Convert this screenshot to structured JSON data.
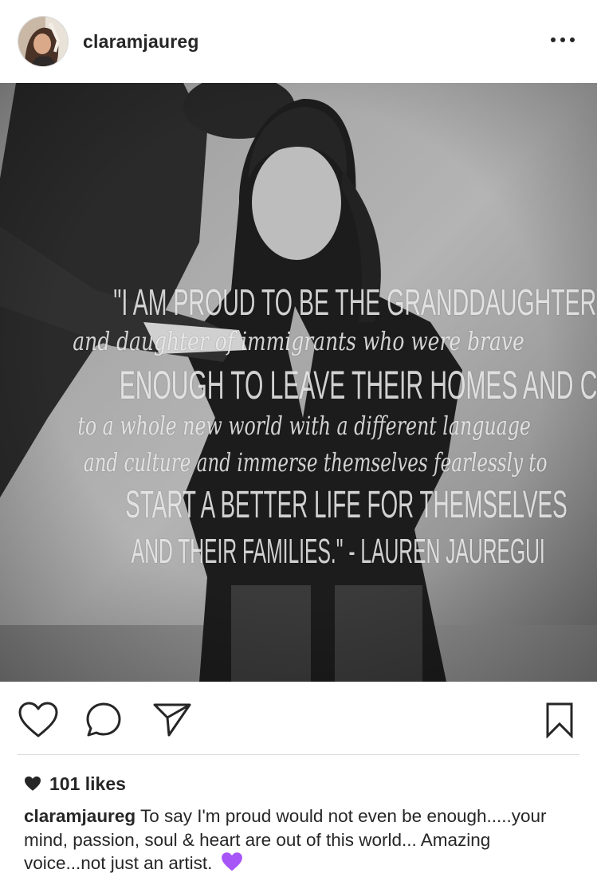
{
  "post": {
    "username": "claramjaureg",
    "more_label": "More options"
  },
  "image": {
    "quote_lines": [
      {
        "text": "\"I AM PROUD TO BE THE GRANDDAUGHTER",
        "style": "cap"
      },
      {
        "text": "and daughter of immigrants who were brave",
        "style": "script"
      },
      {
        "text": "ENOUGH TO LEAVE THEIR HOMES AND COME",
        "style": "cap"
      },
      {
        "text": "to a whole new world with a different language",
        "style": "script"
      },
      {
        "text": "and culture and immerse themselves fearlessly to",
        "style": "script"
      },
      {
        "text": "START A BETTER LIFE FOR THEMSELVES",
        "style": "cap"
      },
      {
        "text": "AND THEIR FAMILIES.\" - LAUREN JAUREGUI",
        "style": "cap"
      }
    ]
  },
  "actions": {
    "like_icon": "heart-icon",
    "comment_icon": "comment-icon",
    "share_icon": "send-icon",
    "save_icon": "bookmark-icon"
  },
  "likes": {
    "text": "101 likes"
  },
  "caption": {
    "username": "claramjaureg",
    "text": "To say I'm proud would not even be enough.....your mind, passion, soul & heart are out of this world... Amazing voice...not just an artist.",
    "emoji": "purple-heart-emoji",
    "emoji_color": "#a855f7"
  },
  "colors": {
    "text": "#262626",
    "divider": "#dbdbdb",
    "background": "#ffffff"
  }
}
